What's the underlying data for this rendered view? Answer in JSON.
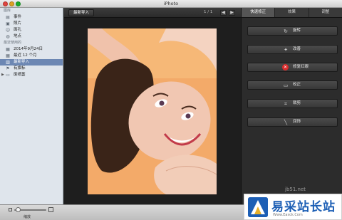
{
  "window": {
    "title": "iPhoto"
  },
  "sidebar": {
    "library_heading": "图库",
    "library_items": [
      {
        "label": "事件",
        "icon": "events-icon"
      },
      {
        "label": "照片",
        "icon": "photos-icon"
      },
      {
        "label": "面孔",
        "icon": "faces-icon"
      },
      {
        "label": "地点",
        "icon": "places-icon"
      }
    ],
    "recent_heading": "最近使用的",
    "recent_items": [
      {
        "label": "2014年9月24日",
        "icon": "calendar-icon"
      },
      {
        "label": "最近 12 个月",
        "icon": "calendar-icon"
      },
      {
        "label": "最新导入",
        "icon": "import-icon",
        "selected": true
      },
      {
        "label": "有旗标",
        "icon": "flag-icon"
      },
      {
        "label": "废纸篓",
        "icon": "trash-icon"
      }
    ]
  },
  "toolbar": {
    "import_label": "最新导入",
    "pager": "1 / 1",
    "prev_glyph": "◀",
    "next_glyph": "▶"
  },
  "edit_panel": {
    "tabs": [
      {
        "label": "快速修正",
        "active": true
      },
      {
        "label": "效果",
        "active": false
      },
      {
        "label": "调整",
        "active": false
      }
    ],
    "tools": [
      {
        "label": "旋转",
        "icon": "rotate-icon",
        "glyph": "↻"
      },
      {
        "label": "改善",
        "icon": "enhance-icon",
        "glyph": "✦"
      },
      {
        "label": "修复红眼",
        "icon": "red-eye-icon",
        "glyph": "✕"
      },
      {
        "label": "校正",
        "icon": "straighten-icon",
        "glyph": "▭"
      },
      {
        "label": "裁剪",
        "icon": "crop-icon",
        "glyph": "⌗"
      },
      {
        "label": "润饰",
        "icon": "retouch-icon",
        "glyph": "╲"
      }
    ]
  },
  "bottombar": {
    "zoom_label": "缩放",
    "zoom_level": 0.05
  },
  "watermark": {
    "name": "易采站长站",
    "url": "Www.Easck.Com",
    "site": "jb51.net"
  },
  "colors": {
    "selection": "#6c87b3",
    "photo_background": "#f2a96a",
    "watermark_blue": "#1d5fb5"
  }
}
